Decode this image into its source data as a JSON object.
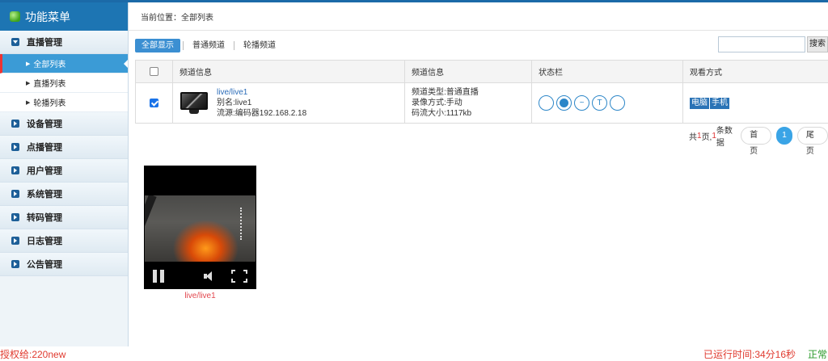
{
  "sidebar": {
    "title": "功能菜单",
    "groups": [
      {
        "label": "直播管理"
      },
      {
        "label": "设备管理"
      },
      {
        "label": "点播管理"
      },
      {
        "label": "用户管理"
      },
      {
        "label": "系统管理"
      },
      {
        "label": "转码管理"
      },
      {
        "label": "日志管理"
      },
      {
        "label": "公告管理"
      }
    ],
    "live_sub_items": [
      {
        "label": "全部列表",
        "active": true
      },
      {
        "label": "直播列表"
      },
      {
        "label": "轮播列表"
      }
    ]
  },
  "breadcrumb": {
    "text": "当前位置：全部列表"
  },
  "filter_tabs": [
    {
      "label": "全部显示",
      "active": true
    },
    {
      "label": "普通频道"
    },
    {
      "label": "轮播频道"
    }
  ],
  "search": {
    "value": "",
    "button_label": "搜索"
  },
  "table": {
    "headers": [
      "频道信息",
      "频道信息",
      "状态栏",
      "观看方式"
    ],
    "rows": [
      {
        "checked": true,
        "name": "live/live1",
        "alias": "别名:live1",
        "source": "流源:编码器192.168.2.18",
        "type": "频道类型:普通直播",
        "record": "录像方式:手动",
        "bitrate": "码流大小:1117kb",
        "status_icons": [
          "circle-icon",
          "camera-icon",
          "wave-icon",
          "t-icon",
          "circle-icon"
        ],
        "watch_badges": [
          "电脑",
          "手机"
        ]
      }
    ]
  },
  "pagination": {
    "prefix": "共",
    "total_pages": "1",
    "mid": "页,",
    "total_records": "1",
    "suffix": "条数据",
    "first_label": "首页",
    "current": "1",
    "last_label": "尾页"
  },
  "player": {
    "caption": "live/live1"
  },
  "footer": {
    "license": "授权给:220new",
    "uptime": "已运行时间:34分16秒",
    "status": "正常"
  },
  "colors": {
    "accent": "#1d75b3",
    "active_item": "#3b9bd6",
    "alert": "#e03a2f",
    "ok": "#2a9a2a"
  }
}
